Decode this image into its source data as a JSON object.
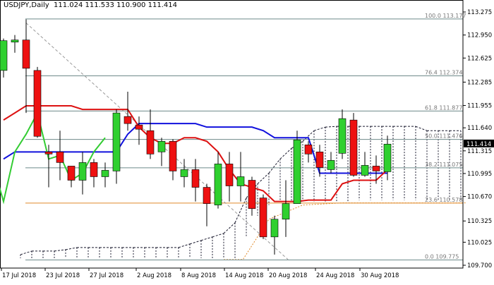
{
  "header": {
    "symbol": "USDJPY,Daily",
    "ohlc": "111.024 111.533 110.900 111.414"
  },
  "colors": {
    "bull": "#2fd02f",
    "bear": "#ee1111",
    "tenkan": "#dd1111",
    "kijun": "#1111dd",
    "chikou": "#33cc33",
    "cloud": "#1a1a2e",
    "fib": "#6e8a8a",
    "trend": "#999999",
    "price_box": "#000000"
  },
  "chart_data": {
    "type": "candlestick",
    "symbol": "USDJPY",
    "timeframe": "Daily",
    "ylim": [
      109.7,
      113.275
    ],
    "grid": false,
    "y_ticks": [
      "113.275",
      "112.950",
      "112.625",
      "112.285",
      "111.955",
      "111.640",
      "111.315",
      "110.995",
      "110.670",
      "110.325",
      "110.025",
      "109.700"
    ],
    "x_ticks": [
      "17 Jul 2018",
      "23 Jul 2018",
      "27 Jul 2018",
      "2 Aug 2018",
      "8 Aug 2018",
      "14 Aug 2018",
      "20 Aug 2018",
      "24 Aug 2018",
      "30 Aug 2018"
    ],
    "current_price": "111.414",
    "candles": [
      {
        "o": 112.45,
        "h": 112.9,
        "l": 112.35,
        "c": 112.87
      },
      {
        "o": 112.85,
        "h": 112.95,
        "l": 112.7,
        "c": 112.88
      },
      {
        "o": 112.88,
        "h": 113.17,
        "l": 111.85,
        "c": 112.48
      },
      {
        "o": 112.45,
        "h": 112.5,
        "l": 111.5,
        "c": 111.52
      },
      {
        "o": 111.3,
        "h": 111.4,
        "l": 110.8,
        "c": 111.27
      },
      {
        "o": 111.3,
        "h": 111.6,
        "l": 110.9,
        "c": 111.15
      },
      {
        "o": 111.1,
        "h": 111.1,
        "l": 110.8,
        "c": 110.9
      },
      {
        "o": 110.9,
        "h": 111.3,
        "l": 110.7,
        "c": 111.15
      },
      {
        "o": 111.15,
        "h": 111.2,
        "l": 110.8,
        "c": 110.95
      },
      {
        "o": 110.95,
        "h": 111.15,
        "l": 110.8,
        "c": 111.04
      },
      {
        "o": 111.03,
        "h": 111.9,
        "l": 110.85,
        "c": 111.85
      },
      {
        "o": 111.8,
        "h": 112.15,
        "l": 111.6,
        "c": 111.7
      },
      {
        "o": 111.68,
        "h": 111.8,
        "l": 111.4,
        "c": 111.62
      },
      {
        "o": 111.6,
        "h": 111.9,
        "l": 111.2,
        "c": 111.27
      },
      {
        "o": 111.3,
        "h": 111.5,
        "l": 111.1,
        "c": 111.45
      },
      {
        "o": 111.45,
        "h": 111.48,
        "l": 110.9,
        "c": 111.03
      },
      {
        "o": 110.95,
        "h": 111.2,
        "l": 110.8,
        "c": 111.05
      },
      {
        "o": 111.05,
        "h": 111.2,
        "l": 110.6,
        "c": 110.8
      },
      {
        "o": 110.8,
        "h": 110.85,
        "l": 110.25,
        "c": 110.57
      },
      {
        "o": 110.55,
        "h": 111.3,
        "l": 110.5,
        "c": 111.13
      },
      {
        "o": 111.13,
        "h": 111.3,
        "l": 110.6,
        "c": 110.82
      },
      {
        "o": 110.82,
        "h": 111.3,
        "l": 110.6,
        "c": 110.95
      },
      {
        "o": 110.9,
        "h": 110.95,
        "l": 110.4,
        "c": 110.5
      },
      {
        "o": 110.65,
        "h": 110.7,
        "l": 110.07,
        "c": 110.1
      },
      {
        "o": 110.1,
        "h": 110.4,
        "l": 109.85,
        "c": 110.35
      },
      {
        "o": 110.35,
        "h": 110.9,
        "l": 110.1,
        "c": 110.57
      },
      {
        "o": 110.57,
        "h": 111.6,
        "l": 110.57,
        "c": 111.47
      },
      {
        "o": 111.4,
        "h": 111.45,
        "l": 111.15,
        "c": 111.27
      },
      {
        "o": 111.3,
        "h": 111.4,
        "l": 110.95,
        "c": 111.08
      },
      {
        "o": 111.05,
        "h": 111.3,
        "l": 111.0,
        "c": 111.18
      },
      {
        "o": 111.28,
        "h": 111.9,
        "l": 111.2,
        "c": 111.77
      },
      {
        "o": 111.75,
        "h": 111.85,
        "l": 110.95,
        "c": 110.97
      },
      {
        "o": 110.97,
        "h": 111.3,
        "l": 110.95,
        "c": 111.11
      },
      {
        "o": 111.1,
        "h": 111.25,
        "l": 110.85,
        "c": 111.03
      },
      {
        "o": 111.02,
        "h": 111.53,
        "l": 110.9,
        "c": 111.41
      }
    ],
    "tenkan": [
      111.75,
      111.85,
      111.95,
      111.95,
      111.95,
      111.95,
      111.95,
      111.9,
      111.9,
      111.9,
      111.9,
      111.9,
      111.65,
      111.5,
      111.42,
      111.42,
      111.5,
      111.5,
      111.45,
      111.3,
      111.05,
      110.85,
      110.8,
      110.75,
      110.6,
      110.6,
      110.6,
      110.62,
      110.62,
      110.62,
      110.85,
      110.9,
      110.9,
      110.9,
      111.05
    ],
    "kijun": [
      111.2,
      111.3,
      111.3,
      111.3,
      111.3,
      111.3,
      111.3,
      111.3,
      111.3,
      111.3,
      111.3,
      111.55,
      111.7,
      111.7,
      111.7,
      111.7,
      111.7,
      111.7,
      111.65,
      111.65,
      111.65,
      111.65,
      111.65,
      111.6,
      111.5,
      111.5,
      111.5,
      111.5,
      111.0,
      111.0,
      111.0,
      111.0,
      111.0,
      111.0,
      111.0
    ],
    "chikou": [
      111.15,
      110.6,
      111.3,
      111.55,
      111.85,
      111.2,
      111.25,
      110.9,
      111.0,
      111.3,
      111.5
    ],
    "cloud_a": [
      109.85,
      109.9,
      109.9,
      109.9,
      109.92,
      109.95,
      109.95,
      109.95,
      109.95,
      109.95,
      109.95,
      109.95,
      109.95,
      109.95,
      109.95,
      110.0,
      110.05,
      110.1,
      110.15,
      110.3,
      110.65,
      110.85,
      111.0,
      111.2,
      111.35,
      111.45,
      111.6,
      111.65,
      111.66,
      111.66,
      111.66,
      111.66,
      111.66,
      111.66,
      111.66,
      111.66,
      111.6,
      111.6,
      111.6,
      111.6
    ],
    "cloud_b": [
      109.8,
      109.8,
      109.8,
      109.8,
      109.8,
      109.8,
      109.8,
      109.8,
      109.8,
      109.8,
      109.8,
      109.8,
      109.8,
      109.8,
      109.8,
      109.8,
      109.8,
      109.8,
      109.8,
      109.8,
      110.1,
      110.4,
      110.55,
      110.6,
      110.6,
      110.6,
      110.6,
      110.6,
      110.6,
      110.6,
      110.62,
      110.62,
      110.62,
      110.62,
      110.62,
      110.62,
      110.62,
      110.62,
      110.62,
      110.62
    ],
    "fib_levels": [
      {
        "label": "100.0 113.177",
        "price": 113.177
      },
      {
        "label": "76.4 112.374",
        "price": 112.374
      },
      {
        "label": "61.8 111.877",
        "price": 111.877
      },
      {
        "label": "50.0 111.476",
        "price": 111.476
      },
      {
        "label": "38.2 111.075",
        "price": 111.075
      },
      {
        "label": "23.6 110.578",
        "price": 110.578
      },
      {
        "label": "0.0 109.775",
        "price": 109.775
      }
    ]
  }
}
